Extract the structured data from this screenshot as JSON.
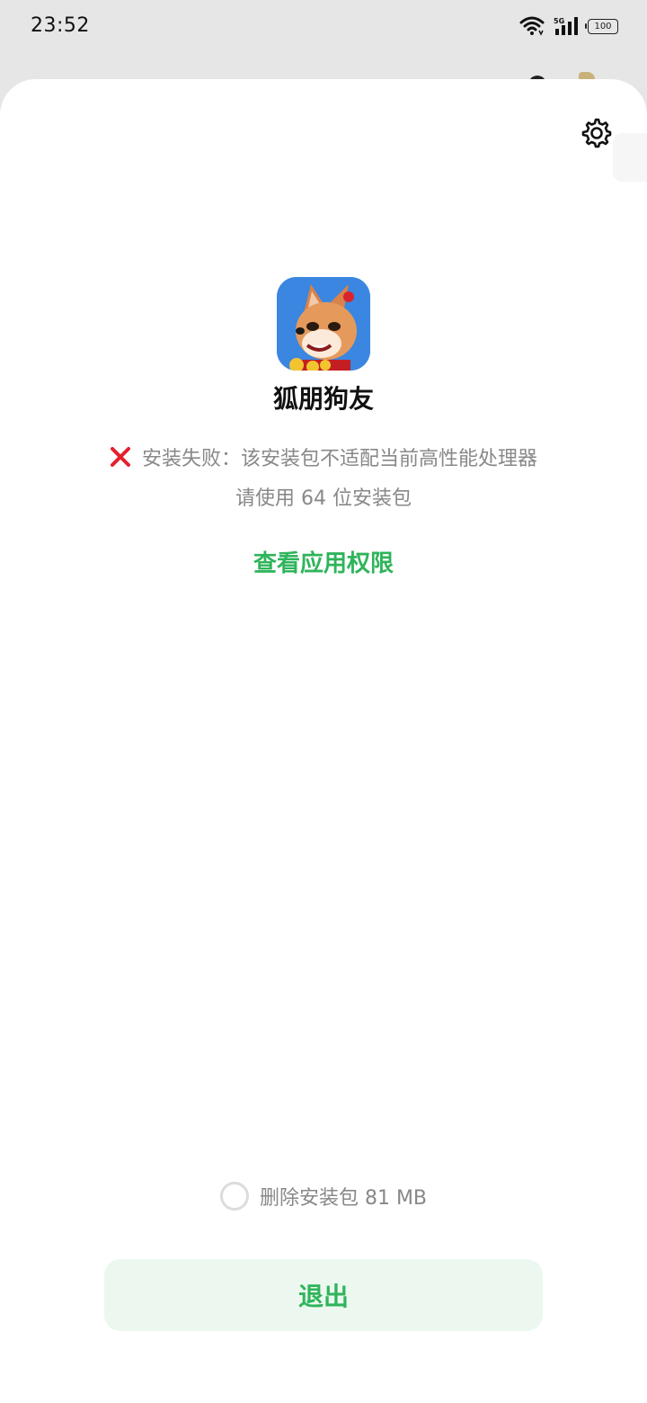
{
  "status_bar": {
    "time": "23:52",
    "network": "5G",
    "battery": "100",
    "icons": [
      "wifi-icon",
      "signal-icon",
      "battery-icon"
    ]
  },
  "dialog": {
    "settings_icon": "gear-icon",
    "app_icon": "fox-app-icon",
    "app_name": "狐朋狗友",
    "error_icon": "cross-icon",
    "error_message": "安装失败：该安装包不适配当前高性能处理器",
    "error_hint": "请使用 64 位安装包",
    "permissions_link": "查看应用权限",
    "delete_package_label": "删除安装包 81 MB",
    "delete_package_checked": false,
    "exit_button": "退出"
  },
  "colors": {
    "accent": "#2fb45b",
    "error": "#e5202e",
    "button_bg": "#ecf8ef",
    "muted_text": "#888888"
  }
}
